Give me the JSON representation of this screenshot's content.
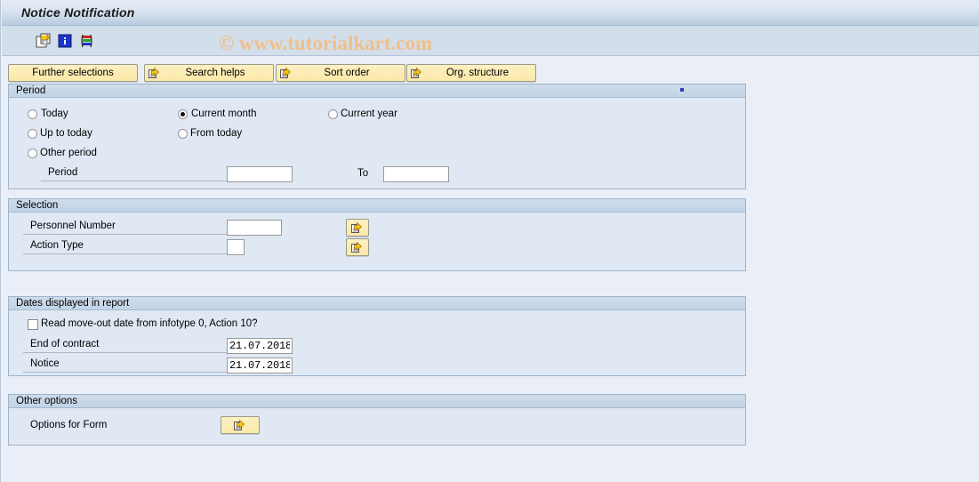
{
  "window": {
    "title": "Notice Notification"
  },
  "watermark": {
    "text": "© www.tutorialkart.com"
  },
  "toolbar": {
    "icons": [
      {
        "name": "copy-icon",
        "label": "Copy"
      },
      {
        "name": "info-icon",
        "label": "Information"
      },
      {
        "name": "variant-icon",
        "label": "Display Variant"
      }
    ]
  },
  "selection_buttons": [
    {
      "label": "Further selections",
      "icon": ""
    },
    {
      "label": "Search helps",
      "icon": "arrow-right-icon"
    },
    {
      "label": "Sort order",
      "icon": "arrow-right-icon"
    },
    {
      "label": "Org. structure",
      "icon": "arrow-right-icon"
    }
  ],
  "period_group": {
    "title": "Period",
    "radios": [
      {
        "label": "Today",
        "checked": false
      },
      {
        "label": "Current month",
        "checked": true
      },
      {
        "label": "Current year",
        "checked": false
      },
      {
        "label": "Up to today",
        "checked": false
      },
      {
        "label": "From today",
        "checked": false
      },
      {
        "label": "Other period",
        "checked": false
      }
    ],
    "period_label": "Period",
    "period_value": "",
    "to_label": "To",
    "to_value": ""
  },
  "selection_group": {
    "title": "Selection",
    "personnel_number_label": "Personnel Number",
    "personnel_number_value": "",
    "action_type_label": "Action Type",
    "action_type_value": "",
    "multi_select_icon": "arrow-right-icon"
  },
  "dates_group": {
    "title": "Dates displayed in report",
    "checkbox_label": "Read move-out date from infotype 0, Action 10?",
    "checkbox_checked": false,
    "end_of_contract_label": "End of contract",
    "end_of_contract_value": "21.07.2018",
    "notice_label": "Notice",
    "notice_value": "21.07.2018"
  },
  "other_group": {
    "title": "Other options",
    "options_for_form_label": "Options for Form",
    "options_for_form_icon": "arrow-right-icon"
  },
  "colors": {
    "title_bar": "#b9cbe0",
    "button_yellow": "#fbe9a8",
    "group_background": "#dfe8f3",
    "page_background": "#eaeff7",
    "watermark": "#f0c089"
  }
}
